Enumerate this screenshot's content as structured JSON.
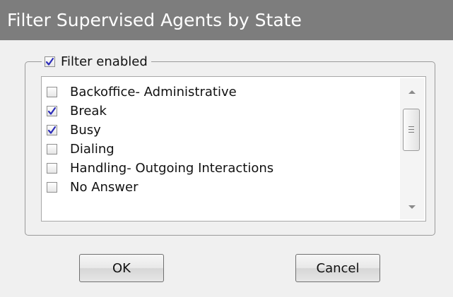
{
  "dialog": {
    "title": "Filter Supervised Agents by State"
  },
  "filter": {
    "label": "Filter enabled",
    "checked": true
  },
  "states": [
    {
      "label": "Backoffice- Administrative",
      "checked": false
    },
    {
      "label": "Break",
      "checked": true
    },
    {
      "label": "Busy",
      "checked": true
    },
    {
      "label": "Dialing",
      "checked": false
    },
    {
      "label": "Handling- Outgoing Interactions",
      "checked": false
    },
    {
      "label": "No Answer",
      "checked": false
    }
  ],
  "buttons": {
    "ok_label": "OK",
    "cancel_label": "Cancel"
  },
  "colors": {
    "titlebar": "#7d7d7d",
    "check_mark": "#2c2cb8"
  }
}
